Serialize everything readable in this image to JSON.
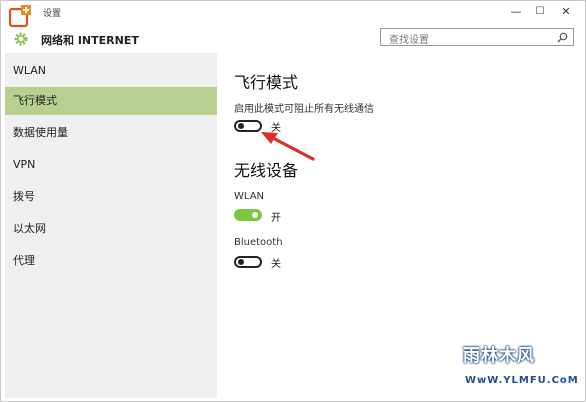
{
  "titlebar": {
    "title": "设置",
    "minimize": "—",
    "maximize": "☐",
    "close": "✕"
  },
  "header": {
    "title": "网络和 INTERNET",
    "icon": "gear-icon"
  },
  "search": {
    "placeholder": "查找设置",
    "icon": "search-icon"
  },
  "sidebar": {
    "items": [
      {
        "label": "WLAN",
        "active": false
      },
      {
        "label": "飞行模式",
        "active": true
      },
      {
        "label": "数据使用量",
        "active": false
      },
      {
        "label": "VPN",
        "active": false
      },
      {
        "label": "拨号",
        "active": false
      },
      {
        "label": "以太网",
        "active": false
      },
      {
        "label": "代理",
        "active": false
      }
    ]
  },
  "main": {
    "airplane": {
      "heading": "飞行模式",
      "description": "启用此模式可阻止所有无线通信",
      "toggle_state": "关",
      "on": false
    },
    "wireless": {
      "heading": "无线设备",
      "wlan": {
        "label": "WLAN",
        "toggle_state": "开",
        "on": true
      },
      "bluetooth": {
        "label": "Bluetooth",
        "toggle_state": "关",
        "on": false
      }
    }
  },
  "colors": {
    "accent": "#b8d08f",
    "toggle_on": "#7cc83a",
    "arrow": "#d9302a"
  },
  "watermark": {
    "line1": "雨林木风",
    "line2": "WwW.YLMFU.CoM"
  }
}
